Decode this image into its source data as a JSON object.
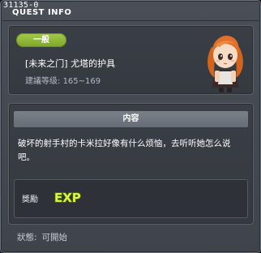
{
  "window": {
    "quest_id": "31135-0",
    "title": "QUEST INFO"
  },
  "header": {
    "category_badge": "一般",
    "quest_name": "[未来之门] 尤塔的护具",
    "level_label": "建議等级",
    "level_range": "165~169",
    "npc_icon": "npc-portrait-girl-orange-hair"
  },
  "content": {
    "section_title": "内容",
    "description": "破坏的射手村的卡米拉好像有什么烦恼，去听听她怎么说吧。",
    "reward_label": "獎勵",
    "reward_icon": "exp-icon",
    "reward_text": "EXP"
  },
  "footer": {
    "status_label": "狀態:",
    "status_value": "可開始"
  },
  "colors": {
    "badge_green": "#8ab534",
    "exp_yellow": "#d9f24a",
    "panel_bg": "#3a3e45"
  }
}
